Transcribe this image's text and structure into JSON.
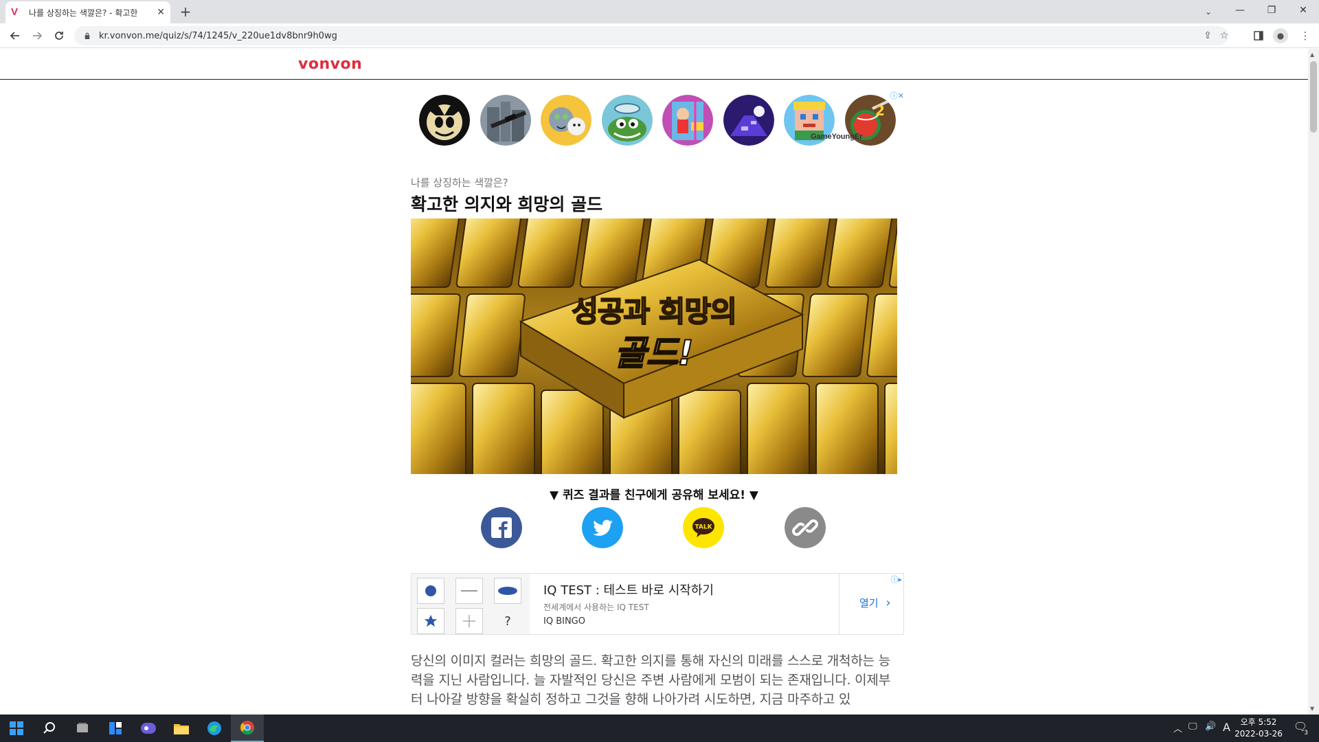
{
  "browser": {
    "tab_title": "나를 상징하는 색깔은? - 확고한",
    "favicon": "V",
    "url": "kr.vonvon.me/quiz/s/74/1245/v_220ue1dv8bnr9h0wg"
  },
  "site": {
    "logo": "vonvon"
  },
  "result": {
    "subtitle": "나를 상징하는 색깔은?",
    "title": "확고한 의지와 희망의 골드",
    "image_text_line1": "성공과 희망의",
    "image_text_line2": "골드!"
  },
  "games_ad": {
    "brand_label": "GameYoungEr"
  },
  "share": {
    "title": "▼ 퀴즈 결과를 친구에게 공유해 보세요! ▼",
    "kakao_label": "TALK"
  },
  "native_ad": {
    "headline": "IQ TEST : 테스트 바로 시작하기",
    "description": "전세계에서 사용하는 IQ TEST",
    "brand": "IQ BINGO",
    "open_label": "열기",
    "grid_question": "?"
  },
  "description": "당신의 이미지 컬러는 희망의 골드. 확고한 의지를 통해 자신의 미래를 스스로 개척하는 능력을 지닌 사람입니다. 늘 자발적인 당신은 주변 사람에게 모범이 되는 존재입니다. 이제부터 나아갈 방향을 확실히 정하고 그것을 향해 나아가려 시도하면, 지금 마주하고 있",
  "taskbar": {
    "clock_time": "오후 5:52",
    "clock_date": "2022-03-26",
    "ime": "A",
    "notification_count": "3"
  },
  "colors": {
    "brand": "#e02c3f",
    "facebook": "#3b5998",
    "twitter": "#1da1f2",
    "kakao": "#fee500",
    "link": "#8a8a8a",
    "gold": "#c9a21c"
  }
}
